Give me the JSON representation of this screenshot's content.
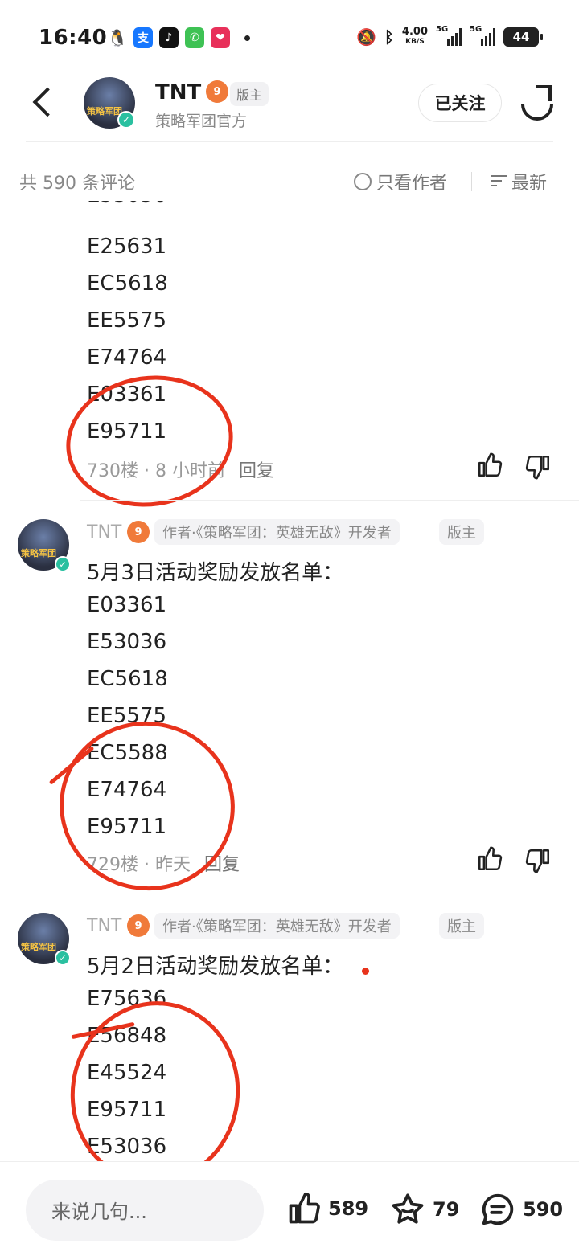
{
  "status_bar": {
    "time": "16:40",
    "net_speed_value": "4.00",
    "net_speed_unit": "KB/S",
    "sig1_tag": "5G",
    "sig2_tag": "5G",
    "battery": "44",
    "app_icons": [
      "qq-icon",
      "alipay-icon",
      "tiktok-icon",
      "phone-icon",
      "health-icon"
    ]
  },
  "header": {
    "back_icon": "chevron-left-icon",
    "name": "TNT",
    "level_badge": "9",
    "role_badge": "版主",
    "subtitle": "策略军团官方",
    "follow_label": "已关注",
    "share_icon": "share-icon",
    "avatar_text": "策略军团"
  },
  "filter": {
    "count_label": "共 590 条评论",
    "only_author_label": "只看作者",
    "sort_label": "最新"
  },
  "comments": [
    {
      "lines": [
        "E25631",
        "EC5618",
        "EE5575",
        "E74764",
        "E03361",
        "E95711"
      ],
      "floor_time": "730楼 · 8 小时前",
      "reply": "回复"
    },
    {
      "author": "TNT",
      "author_tag": "作者·《策略军团：英雄无敌》开发者",
      "role": "版主",
      "title": "5月3日活动奖励发放名单：",
      "lines": [
        "E03361",
        "E53036",
        "EC5618",
        "EE5575",
        "EC5588",
        "E74764",
        "E95711"
      ],
      "floor_time": "729楼 · 昨天",
      "reply": "回复"
    },
    {
      "author": "TNT",
      "author_tag": "作者·《策略军团：英雄无敌》开发者",
      "role": "版主",
      "title": "5月2日活动奖励发放名单：",
      "lines": [
        "E75636",
        "E56848",
        "E45524",
        "E95711",
        "E53036"
      ]
    }
  ],
  "bottom_bar": {
    "input_placeholder": "来说几句...",
    "likes": "589",
    "favorites": "79",
    "comments": "590"
  },
  "colors": {
    "accent_red_annotation": "#e8331c",
    "verify_green": "#2ac0a0",
    "level_orange": "#f07a3a"
  }
}
